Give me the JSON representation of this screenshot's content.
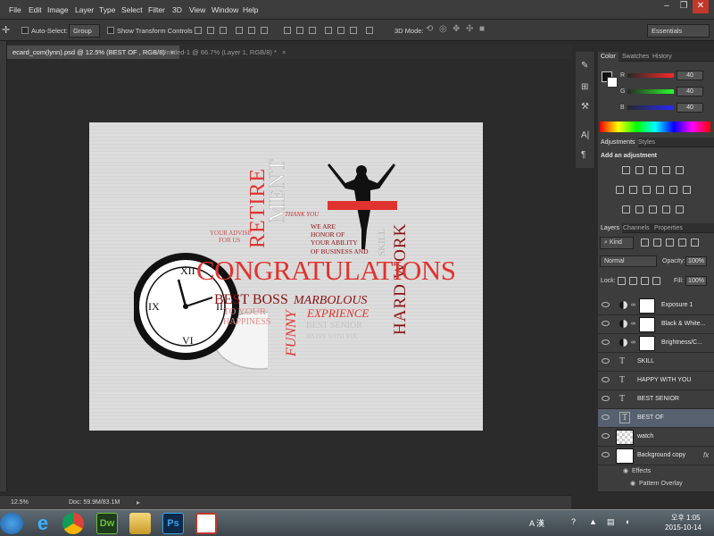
{
  "menubar": {
    "items": [
      "File",
      "Edit",
      "Image",
      "Layer",
      "Type",
      "Select",
      "Filter",
      "3D",
      "View",
      "Window",
      "Help"
    ]
  },
  "window_controls": {
    "minimize": "–",
    "maximize": "❐",
    "close": "✕"
  },
  "options_bar": {
    "auto_select_label": "Auto-Select:",
    "auto_select_value": "Group",
    "transform_controls_label": "Show Transform Controls",
    "mode_3d_label": "3D Mode:",
    "workspace": "Essentials"
  },
  "doc_tabs": [
    {
      "label": "ecard_com(lynn).psd @ 12.5% (BEST OF , RGB/8)",
      "close": "×",
      "active": true
    },
    {
      "label": "Untitled-1 @ 66.7% (Layer 1, RGB/8) *",
      "close": "×",
      "active": false
    }
  ],
  "artwork": {
    "congratulations": "CONGRATULATIONS",
    "retire": "RETIRE",
    "ment": "MENT",
    "thank_you": "THANK YOU",
    "we_are_honor": [
      "WE ARE",
      "HONOR OF",
      "YOUR ABILITY",
      "OF BUSINESS AND"
    ],
    "your_advise": [
      "YOUR ADVISE",
      "FOR US"
    ],
    "hard_work": "HARD WORK",
    "skill": "SKILL",
    "best_boss": "BEST BOSS",
    "marbolous": "MARBOLOUS",
    "exprience": "EXPRIENCE",
    "funny": "FUNNY",
    "best_senior": "BEST SENIOR",
    "happy_with_you": "HAPPY WITH YOU",
    "to_your": "TO YOUR",
    "happiness": "HAPPINESS",
    "colors": {
      "red": "#e0332f",
      "dark_red": "#8a1414",
      "pink": "#e88b8b",
      "gray": "#bdbdbd"
    }
  },
  "status_bar": {
    "zoom": "12.5%",
    "doc": "Doc: 59.9M/83.1M"
  },
  "color_panel": {
    "tabs": [
      "Color",
      "Swatches",
      "History"
    ],
    "r_label": "R",
    "g_label": "G",
    "b_label": "B",
    "r": "40",
    "g": "40",
    "b": "40"
  },
  "adjustments_panel": {
    "tabs": [
      "Adjustments",
      "Styles"
    ],
    "title": "Add an adjustment"
  },
  "layers_panel": {
    "tabs": [
      "Layers",
      "Channels",
      "Properties"
    ],
    "filter_kind": "Kind",
    "blend_mode": "Normal",
    "opacity_label": "Opacity:",
    "opacity": "100%",
    "lock_label": "Lock:",
    "fill_label": "Fill:",
    "fill": "100%",
    "layers": [
      {
        "name": "Exposure 1",
        "kind": "adjustment"
      },
      {
        "name": "Black & White...",
        "kind": "adjustment"
      },
      {
        "name": "Brightness/C...",
        "kind": "adjustment"
      },
      {
        "name": "SKILL",
        "kind": "text"
      },
      {
        "name": "HAPPY WITH YOU",
        "kind": "text"
      },
      {
        "name": "BEST SENIOR",
        "kind": "text"
      },
      {
        "name": "BEST OF",
        "kind": "text",
        "selected": true
      },
      {
        "name": "watch",
        "kind": "image"
      },
      {
        "name": "Background copy",
        "kind": "image",
        "fx": "fx"
      }
    ],
    "effects_label": "Effects",
    "pattern_overlay_label": "Pattern Overlay"
  },
  "taskbar": {
    "ime": "A 漢",
    "time": "오후 1:05",
    "date": "2015-10-14",
    "apps": [
      "start",
      "ie",
      "chrome",
      "dreamweaver",
      "explorer",
      "photoshop",
      "pdf"
    ],
    "dw_label": "Dw",
    "ps_label": "Ps"
  }
}
